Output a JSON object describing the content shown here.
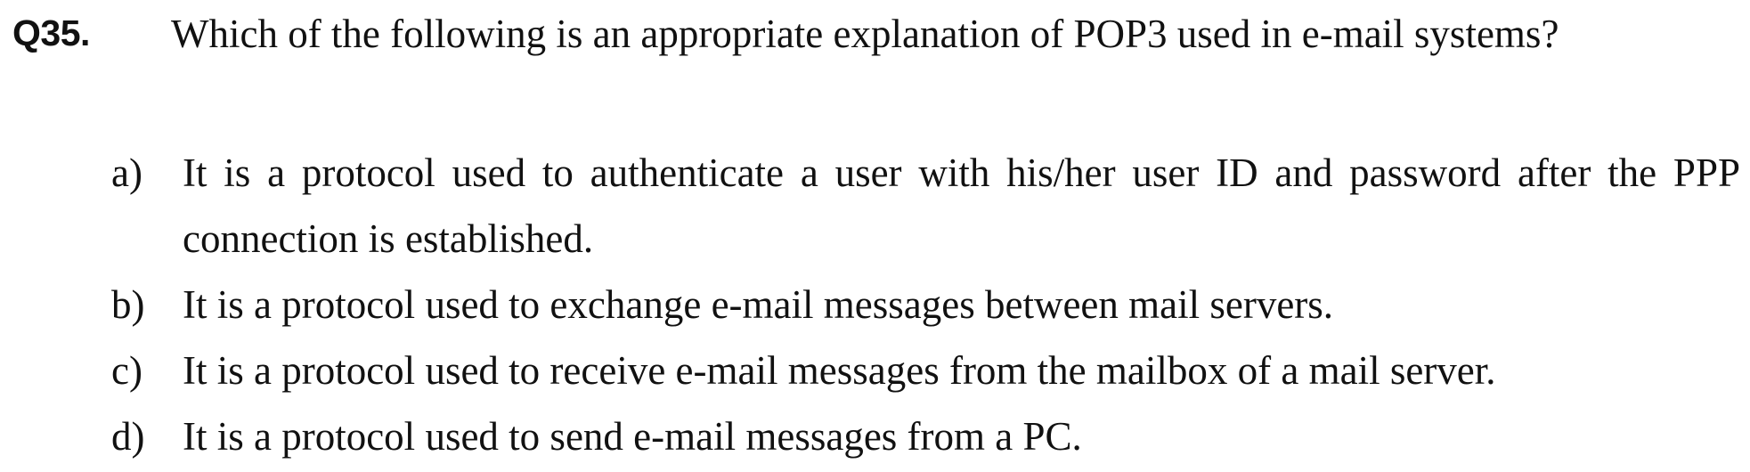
{
  "question": {
    "number": "Q35.",
    "text": "Which of the following is an appropriate explanation of POP3 used in e-mail systems?"
  },
  "options": [
    {
      "label": "a)",
      "text": "It is a protocol used to authenticate a user with his/her user ID and password after the PPP connection is established."
    },
    {
      "label": "b)",
      "text": "It is a protocol used to exchange e-mail messages between mail servers."
    },
    {
      "label": "c)",
      "text": "It is a protocol used to receive e-mail messages from the mailbox of a mail server."
    },
    {
      "label": "d)",
      "text": "It is a protocol used to send e-mail messages from a PC."
    }
  ]
}
